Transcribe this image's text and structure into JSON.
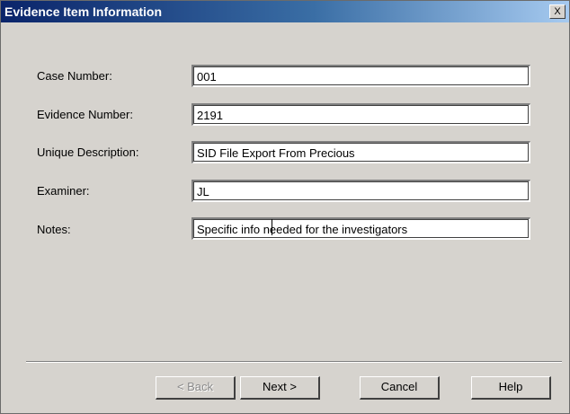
{
  "window": {
    "title": "Evidence Item Information",
    "close_glyph": "X"
  },
  "fields": [
    {
      "label": "Case Number:",
      "value": "001"
    },
    {
      "label": "Evidence Number:",
      "value": "2191"
    },
    {
      "label": "Unique Description:",
      "value": "SID File Export From Precious"
    },
    {
      "label": "Examiner:",
      "value": "JL"
    },
    {
      "label": "Notes:",
      "value": "Specific info needed for the investigators"
    }
  ],
  "buttons": {
    "back": "< Back",
    "next": "Next >",
    "cancel": "Cancel",
    "help": "Help"
  },
  "colors": {
    "face": "#d6d3ce",
    "title_start": "#0a246a",
    "title_end": "#a6caf0"
  }
}
